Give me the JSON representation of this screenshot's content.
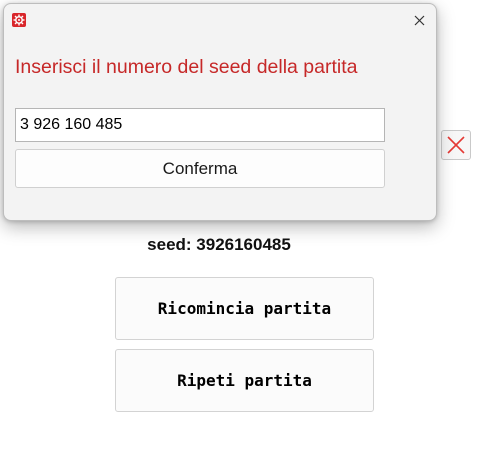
{
  "background": {
    "seed_text": "seed: 3926160485",
    "restart_button_label": "Ricomincia partita",
    "repeat_button_label": "Ripeti partita",
    "close_icon": "x-icon",
    "accent_color": "#e53935"
  },
  "dialog": {
    "app_icon": "gear-icon",
    "close_icon": "close-icon",
    "prompt": "Inserisci il numero del seed della partita",
    "prompt_color": "#c62828",
    "input_value": "3 926 160 485",
    "confirm_label": "Conferma"
  }
}
